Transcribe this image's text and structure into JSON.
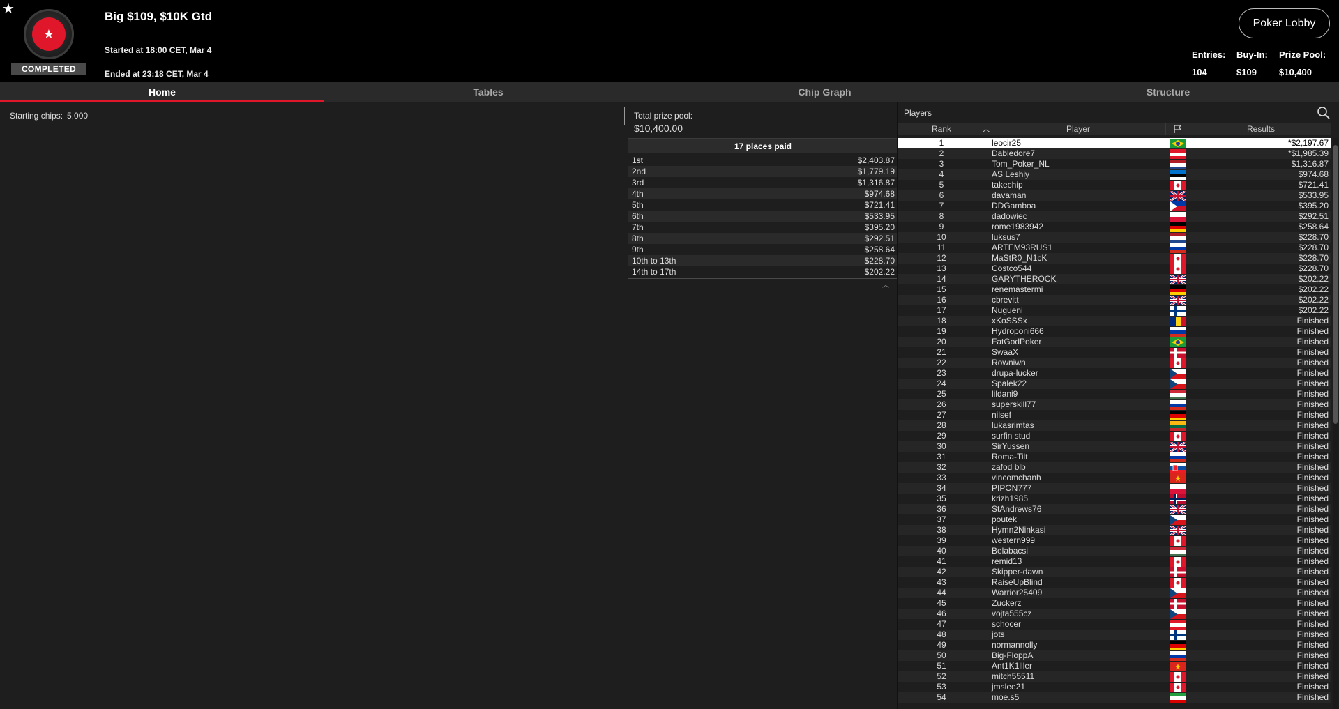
{
  "header": {
    "logo_label": "COMPLETED",
    "title": "Big $109, $10K Gtd",
    "started": "Started at 18:00 CET, Mar 4",
    "ended": "Ended at 23:18 CET, Mar 4",
    "lobby_button": "Poker Lobby",
    "entries_label": "Entries:",
    "entries_value": "104",
    "buyin_label": "Buy-In:",
    "buyin_value": "$109",
    "prizepool_label": "Prize Pool:",
    "prizepool_value": "$10,400"
  },
  "tabs": [
    "Home",
    "Tables",
    "Chip Graph",
    "Structure"
  ],
  "home": {
    "starting_chips_label": "Starting chips:",
    "starting_chips_value": "5,000"
  },
  "prize": {
    "pool_label": "Total prize pool:",
    "pool_value": "$10,400.00",
    "places_paid": "17 places paid",
    "payouts": [
      {
        "place": "1st",
        "amount": "$2,403.87"
      },
      {
        "place": "2nd",
        "amount": "$1,779.19"
      },
      {
        "place": "3rd",
        "amount": "$1,316.87"
      },
      {
        "place": "4th",
        "amount": "$974.68"
      },
      {
        "place": "5th",
        "amount": "$721.41"
      },
      {
        "place": "6th",
        "amount": "$533.95"
      },
      {
        "place": "7th",
        "amount": "$395.20"
      },
      {
        "place": "8th",
        "amount": "$292.51"
      },
      {
        "place": "9th",
        "amount": "$258.64"
      },
      {
        "place": "10th to 13th",
        "amount": "$228.70"
      },
      {
        "place": "14th to 17th",
        "amount": "$202.22"
      }
    ]
  },
  "players": {
    "title": "Players",
    "columns": {
      "rank": "Rank",
      "player": "Player",
      "results": "Results"
    },
    "rows": [
      {
        "rank": "1",
        "name": "leocir25",
        "flag": "br",
        "result": "*$2,197.67"
      },
      {
        "rank": "2",
        "name": "Dabledore7",
        "flag": "at",
        "result": "*$1,985.39"
      },
      {
        "rank": "3",
        "name": "Tom_Poker_NL",
        "flag": "nl",
        "result": "$1,316.87"
      },
      {
        "rank": "4",
        "name": "AS Leshiy",
        "flag": "ee",
        "result": "$974.68"
      },
      {
        "rank": "5",
        "name": "takechip",
        "flag": "ca",
        "result": "$721.41"
      },
      {
        "rank": "6",
        "name": "davaman",
        "flag": "gb",
        "result": "$533.95"
      },
      {
        "rank": "7",
        "name": "DDGamboa",
        "flag": "ph",
        "result": "$395.20"
      },
      {
        "rank": "8",
        "name": "dadowiec",
        "flag": "pl",
        "result": "$292.51"
      },
      {
        "rank": "9",
        "name": "rome1983942",
        "flag": "de",
        "result": "$258.64"
      },
      {
        "rank": "10",
        "name": "luksus7",
        "flag": "nl",
        "result": "$228.70"
      },
      {
        "rank": "11",
        "name": "ARTEM93RUS1",
        "flag": "ru",
        "result": "$228.70"
      },
      {
        "rank": "12",
        "name": "MaStR0_N1cK",
        "flag": "ca",
        "result": "$228.70"
      },
      {
        "rank": "13",
        "name": "Costco544",
        "flag": "ca",
        "result": "$228.70"
      },
      {
        "rank": "14",
        "name": "GARYTHEROCK",
        "flag": "gb",
        "result": "$202.22"
      },
      {
        "rank": "15",
        "name": "renemastermi",
        "flag": "de",
        "result": "$202.22"
      },
      {
        "rank": "16",
        "name": "cbrevitt",
        "flag": "gb",
        "result": "$202.22"
      },
      {
        "rank": "17",
        "name": "Nugueni",
        "flag": "fi",
        "result": "$202.22"
      },
      {
        "rank": "18",
        "name": "xKoSSSx",
        "flag": "ro",
        "result": "Finished"
      },
      {
        "rank": "19",
        "name": "Hydroponi666",
        "flag": "ru",
        "result": "Finished"
      },
      {
        "rank": "20",
        "name": "FatGodPoker",
        "flag": "br",
        "result": "Finished"
      },
      {
        "rank": "21",
        "name": "SwaaX",
        "flag": "dk",
        "result": "Finished"
      },
      {
        "rank": "22",
        "name": "Rowniwn",
        "flag": "ca",
        "result": "Finished"
      },
      {
        "rank": "23",
        "name": "drupa-lucker",
        "flag": "cz",
        "result": "Finished"
      },
      {
        "rank": "24",
        "name": "Spalek22",
        "flag": "cz",
        "result": "Finished"
      },
      {
        "rank": "25",
        "name": "lildani9",
        "flag": "hu",
        "result": "Finished"
      },
      {
        "rank": "26",
        "name": "superskill77",
        "flag": "ru",
        "result": "Finished"
      },
      {
        "rank": "27",
        "name": "nilsef",
        "flag": "de",
        "result": "Finished"
      },
      {
        "rank": "28",
        "name": "lukasrimtas",
        "flag": "lt",
        "result": "Finished"
      },
      {
        "rank": "29",
        "name": "surfin stud",
        "flag": "ca",
        "result": "Finished"
      },
      {
        "rank": "30",
        "name": "SirYussen",
        "flag": "gb",
        "result": "Finished"
      },
      {
        "rank": "31",
        "name": "Roma-Tilt",
        "flag": "ru",
        "result": "Finished"
      },
      {
        "rank": "32",
        "name": "zafod blb",
        "flag": "sk",
        "result": "Finished"
      },
      {
        "rank": "33",
        "name": "vincomchanh",
        "flag": "vn",
        "result": "Finished"
      },
      {
        "rank": "34",
        "name": "PIPON777",
        "flag": "pl",
        "result": "Finished"
      },
      {
        "rank": "35",
        "name": "krizh1985",
        "flag": "no",
        "result": "Finished"
      },
      {
        "rank": "36",
        "name": "StAndrews76",
        "flag": "gb",
        "result": "Finished"
      },
      {
        "rank": "37",
        "name": "poutek",
        "flag": "cz",
        "result": "Finished"
      },
      {
        "rank": "38",
        "name": "Hymn2Ninkasi",
        "flag": "gb",
        "result": "Finished"
      },
      {
        "rank": "39",
        "name": "western999",
        "flag": "ca",
        "result": "Finished"
      },
      {
        "rank": "40",
        "name": "Belabacsi",
        "flag": "hu",
        "result": "Finished"
      },
      {
        "rank": "41",
        "name": "remid13",
        "flag": "ca",
        "result": "Finished"
      },
      {
        "rank": "42",
        "name": "Skipper-dawn",
        "flag": "dk",
        "result": "Finished"
      },
      {
        "rank": "43",
        "name": "RaiseUpBlind",
        "flag": "ca",
        "result": "Finished"
      },
      {
        "rank": "44",
        "name": "Warrior25409",
        "flag": "cz",
        "result": "Finished"
      },
      {
        "rank": "45",
        "name": "Zuckerz",
        "flag": "dk",
        "result": "Finished"
      },
      {
        "rank": "46",
        "name": "vojta555cz",
        "flag": "cz",
        "result": "Finished"
      },
      {
        "rank": "47",
        "name": "schocer",
        "flag": "at",
        "result": "Finished"
      },
      {
        "rank": "48",
        "name": "jots",
        "flag": "fi",
        "result": "Finished"
      },
      {
        "rank": "49",
        "name": "normannolly",
        "flag": "de",
        "result": "Finished"
      },
      {
        "rank": "50",
        "name": "Big-FloppA",
        "flag": "ru",
        "result": "Finished"
      },
      {
        "rank": "51",
        "name": "Ant1K1lller",
        "flag": "vn",
        "result": "Finished"
      },
      {
        "rank": "52",
        "name": "mitch55511",
        "flag": "ca",
        "result": "Finished"
      },
      {
        "rank": "53",
        "name": "jmslee21",
        "flag": "ca",
        "result": "Finished"
      },
      {
        "rank": "54",
        "name": "moe.s5",
        "flag": "ir",
        "result": "Finished"
      }
    ]
  },
  "colors": {
    "accent": "#e0162b",
    "background": "#1e1e1e",
    "header_bg": "#000000"
  }
}
